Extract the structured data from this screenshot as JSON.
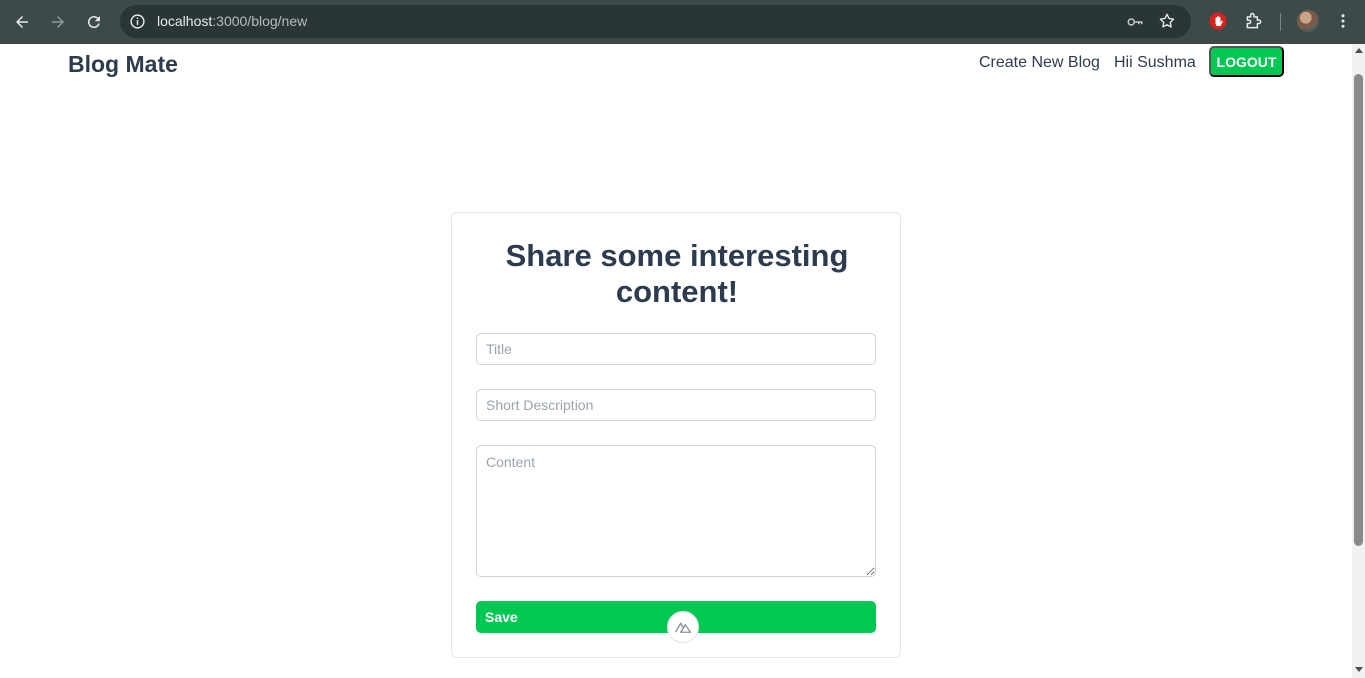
{
  "browser": {
    "url_host": "localhost",
    "url_path": ":3000/blog/new",
    "icons": {
      "back": "back-arrow-icon",
      "forward": "forward-arrow-icon",
      "reload": "reload-icon",
      "info": "site-info-icon",
      "key": "password-key-icon",
      "star": "bookmark-star-icon",
      "extension_red": "adblock-extension-icon",
      "extensions": "puzzle-icon",
      "menu": "more-vertical-icon"
    }
  },
  "header": {
    "brand": "Blog Mate",
    "create_link": "Create New Blog",
    "greeting": "Hii Sushma",
    "logout_label": "LOGOUT"
  },
  "form": {
    "heading": "Share some interesting content!",
    "title_placeholder": "Title",
    "description_placeholder": "Short Description",
    "content_placeholder": "Content",
    "save_label": "Save"
  },
  "colors": {
    "accent": "#00c853",
    "text": "#2d3b4e",
    "chrome": "#3c4a4a"
  }
}
